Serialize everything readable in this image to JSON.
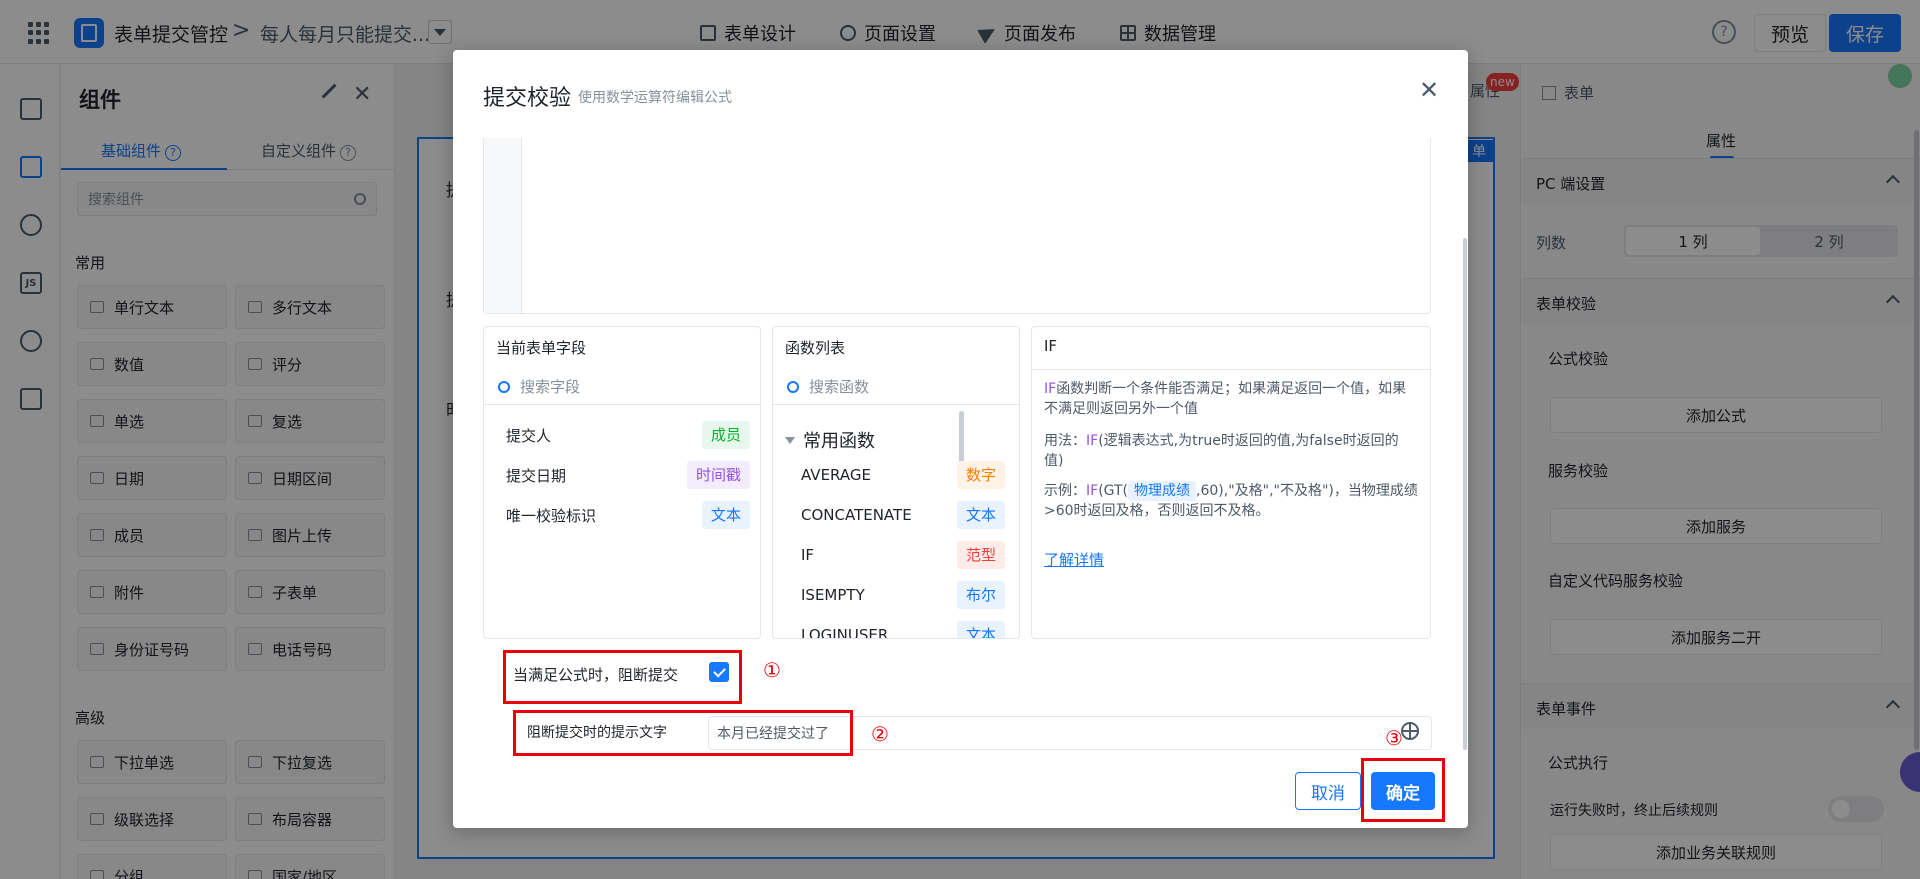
{
  "header": {
    "app_name": "表单提交管控",
    "breadcrumb_sep": ">",
    "form_name": "每人每月只能提交...",
    "tabs": [
      "表单设计",
      "页面设置",
      "页面发布",
      "数据管理"
    ],
    "help": "?",
    "preview_label": "预览",
    "save_label": "保存"
  },
  "components": {
    "title": "组件",
    "close": "✕",
    "tab_basic": "基础组件",
    "tab_custom": "自定义组件",
    "search_placeholder": "搜索组件",
    "group_common": "常用",
    "common_items": [
      "单行文本",
      "多行文本",
      "数值",
      "评分",
      "单选",
      "复选",
      "日期",
      "日期区间",
      "成员",
      "图片上传",
      "附件",
      "子表单",
      "身份证号码",
      "电话号码"
    ],
    "group_advanced": "高级",
    "advanced_items": [
      "下拉单选",
      "下拉复选",
      "级联选择",
      "布局容器",
      "分组",
      "国家/地区"
    ]
  },
  "canvas": {
    "tag": "单",
    "labels": [
      "提",
      "提",
      "时"
    ]
  },
  "right_panel": {
    "attr_tab": "属性",
    "new_badge": "new",
    "form_tab": "表单",
    "sub_tab": "属性",
    "pc_settings": "PC 端设置",
    "columns_label": "列数",
    "col_options": [
      "1 列",
      "2 列"
    ],
    "form_validation": "表单校验",
    "formula_validation": "公式校验",
    "add_formula": "添加公式",
    "service_validation": "服务校验",
    "add_service": "添加服务",
    "custom_code_validation": "自定义代码服务校验",
    "add_service_dev": "添加服务二开",
    "form_events": "表单事件",
    "formula_exec": "公式执行",
    "stop_on_fail": "运行失败时，终止后续规则",
    "add_biz_rule": "添加业务关联规则"
  },
  "dialog": {
    "title": "提交校验",
    "subtitle": "使用数学运算符编辑公式",
    "close": "✕",
    "fields_panel": {
      "title": "当前表单字段",
      "search_placeholder": "搜索字段",
      "items": [
        {
          "name": "提交人",
          "type": "成员"
        },
        {
          "name": "提交日期",
          "type": "时间戳"
        },
        {
          "name": "唯一校验标识",
          "type": "文本"
        }
      ]
    },
    "functions_panel": {
      "title": "函数列表",
      "search_placeholder": "搜索函数",
      "group": "常用函数",
      "items": [
        {
          "name": "AVERAGE",
          "type": "数字"
        },
        {
          "name": "CONCATENATE",
          "type": "文本"
        },
        {
          "name": "IF",
          "type": "范型"
        },
        {
          "name": "ISEMPTY",
          "type": "布尔"
        },
        {
          "name": "LOGINUSER",
          "type": "文本"
        }
      ]
    },
    "desc_panel": {
      "title": "IF",
      "fn": "IF",
      "desc_text": "函数判断一个条件能否满足；如果满足返回一个值，如果不满足则返回另外一个值",
      "usage_prefix": "用法：",
      "usage_fn": "IF",
      "usage_text": "(逻辑表达式,为true时返回的值,为false时返回的值)",
      "example_prefix": "示例：",
      "example_fn": "IF",
      "example_gt": "(GT(",
      "example_chip": "物理成绩",
      "example_rest": ",60),\"及格\",\"不及格\")，当物理成绩>60时返回及格，否则返回不及格。",
      "learn_more": "了解详情"
    },
    "block_label": "当满足公式时，阻断提交",
    "tip_label": "阻断提交时的提示文字",
    "tip_value": "本月已经提交过了",
    "marks": [
      "①",
      "②",
      "③"
    ],
    "cancel_label": "取消",
    "ok_label": "确定"
  }
}
